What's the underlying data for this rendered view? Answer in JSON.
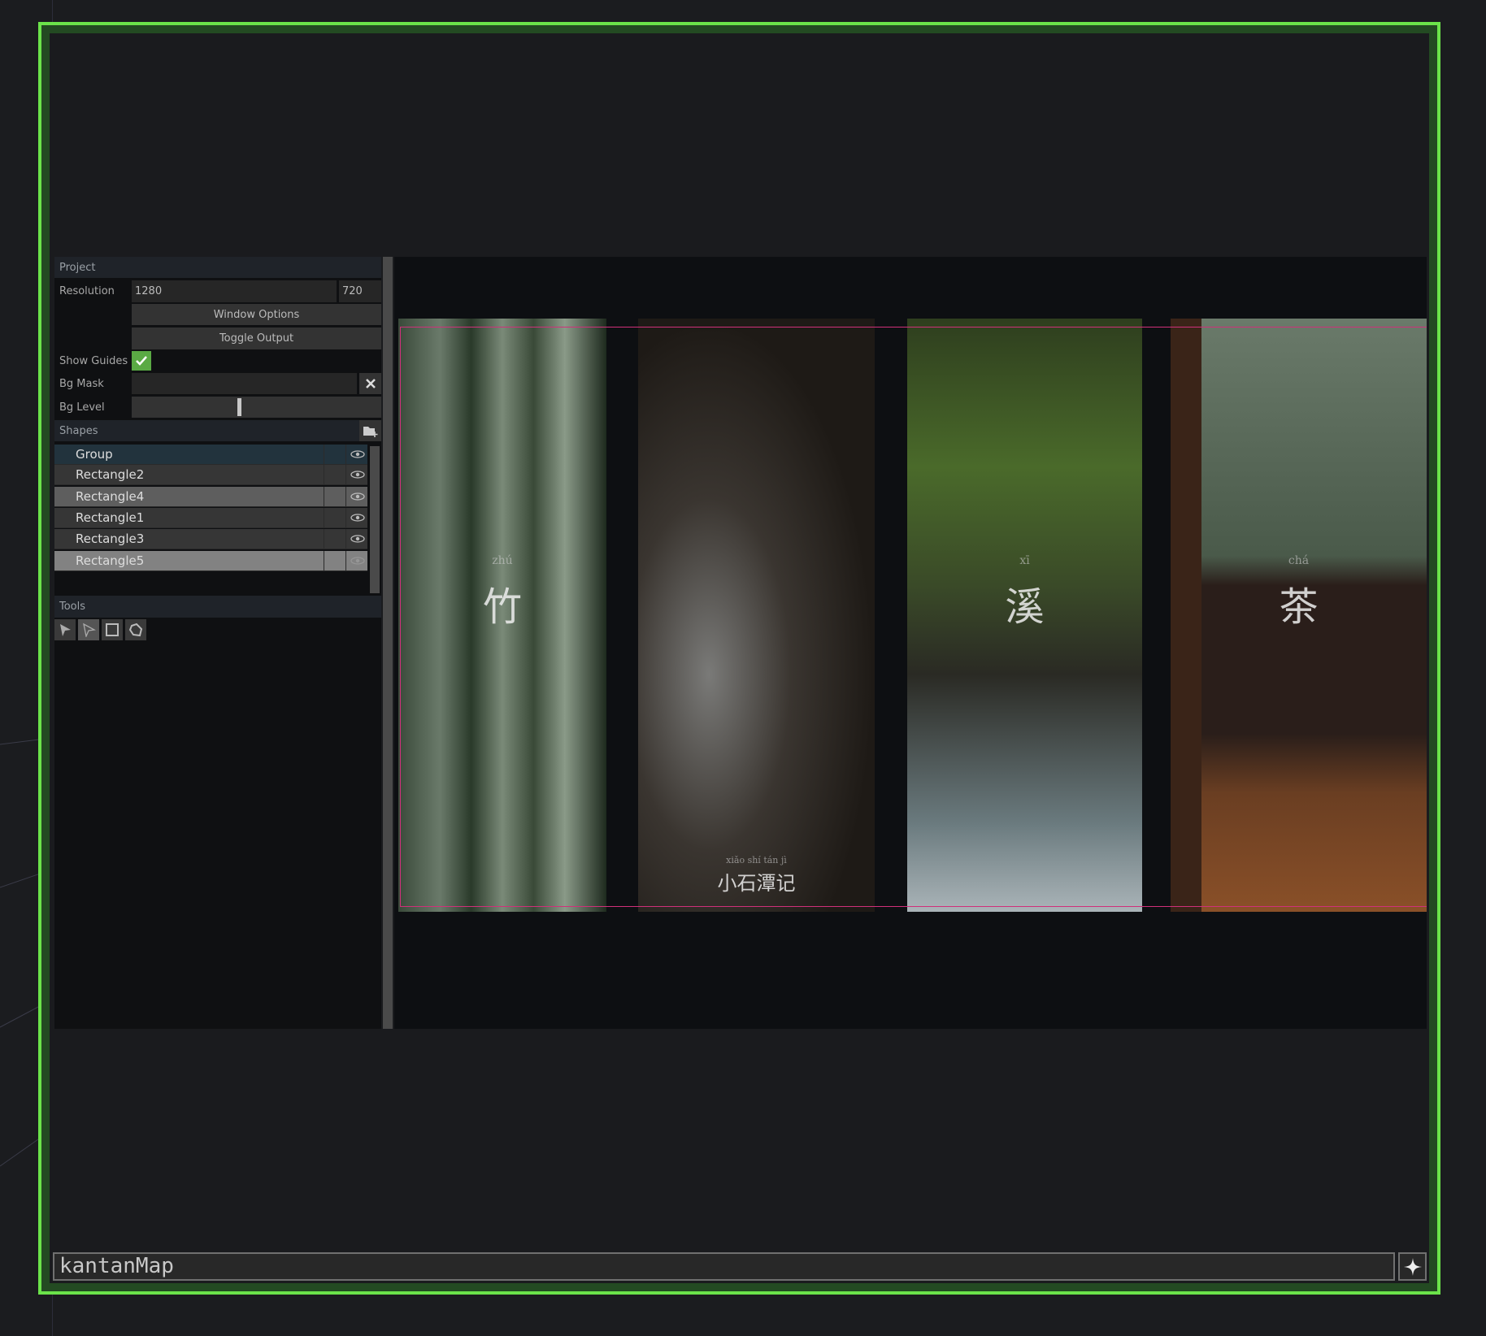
{
  "colors": {
    "frame": "#6be34a",
    "guide": "#d0307a",
    "check": "#5aaa44"
  },
  "project": {
    "header": "Project",
    "resolution_label": "Resolution",
    "res_width": "1280",
    "res_height": "720",
    "window_options": "Window Options",
    "toggle_output": "Toggle Output",
    "show_guides_label": "Show Guides",
    "show_guides": true,
    "bg_mask_label": "Bg Mask",
    "bg_mask_value": "",
    "bg_level_label": "Bg Level",
    "bg_level": 0.43
  },
  "shapes": {
    "header": "Shapes",
    "items": [
      {
        "label": "Group"
      },
      {
        "label": "Rectangle2"
      },
      {
        "label": "Rectangle4"
      },
      {
        "label": "Rectangle1"
      },
      {
        "label": "Rectangle3"
      },
      {
        "label": "Rectangle5"
      }
    ]
  },
  "tools": {
    "header": "Tools",
    "items": [
      "select-icon",
      "direct-select-icon",
      "rectangle-icon",
      "lasso-icon"
    ]
  },
  "viewer": {
    "panels": [
      {
        "pinyin": "zhú",
        "char": "竹"
      },
      {
        "pinyin": "xiǎo shí tán jì",
        "char": "小石潭记"
      },
      {
        "pinyin": "xī",
        "char": "溪"
      },
      {
        "pinyin": "chá",
        "char": "茶"
      }
    ]
  },
  "bottom": {
    "node_name": "kantanMap"
  }
}
